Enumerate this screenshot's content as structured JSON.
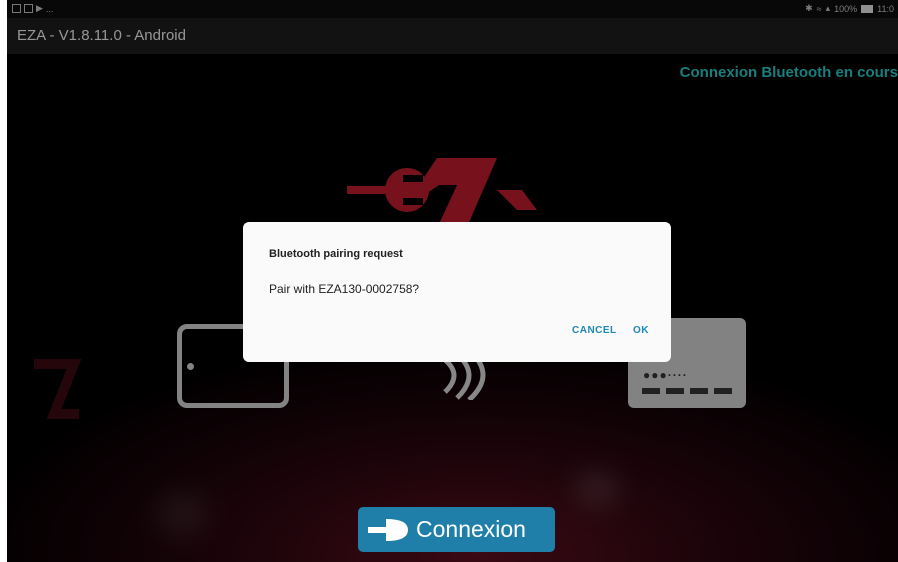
{
  "status_bar": {
    "left_dots": "...",
    "battery": "100%",
    "time": "11:0"
  },
  "app_bar": {
    "title": "EZA - V1.8.11.0 - Android"
  },
  "main": {
    "connection_status": "Connexion Bluetooth en cours",
    "device_icon": "ezl-device-icon",
    "tablet_icon": "tablet-icon",
    "wireless_icon": "wireless-waves-icon",
    "logo_icon": "ez-plug-logo-icon"
  },
  "dialog": {
    "title": "Bluetooth pairing request",
    "message": "Pair with EZA130-0002758?",
    "cancel_label": "CANCEL",
    "ok_label": "OK"
  },
  "connect_button": {
    "label": "Connexion",
    "icon": "plug-icon"
  },
  "colors": {
    "accent_cyan": "#27c2c0",
    "button_blue": "#207fa8",
    "logo_red": "#b71c2c",
    "dialog_action": "#1e88b5"
  }
}
